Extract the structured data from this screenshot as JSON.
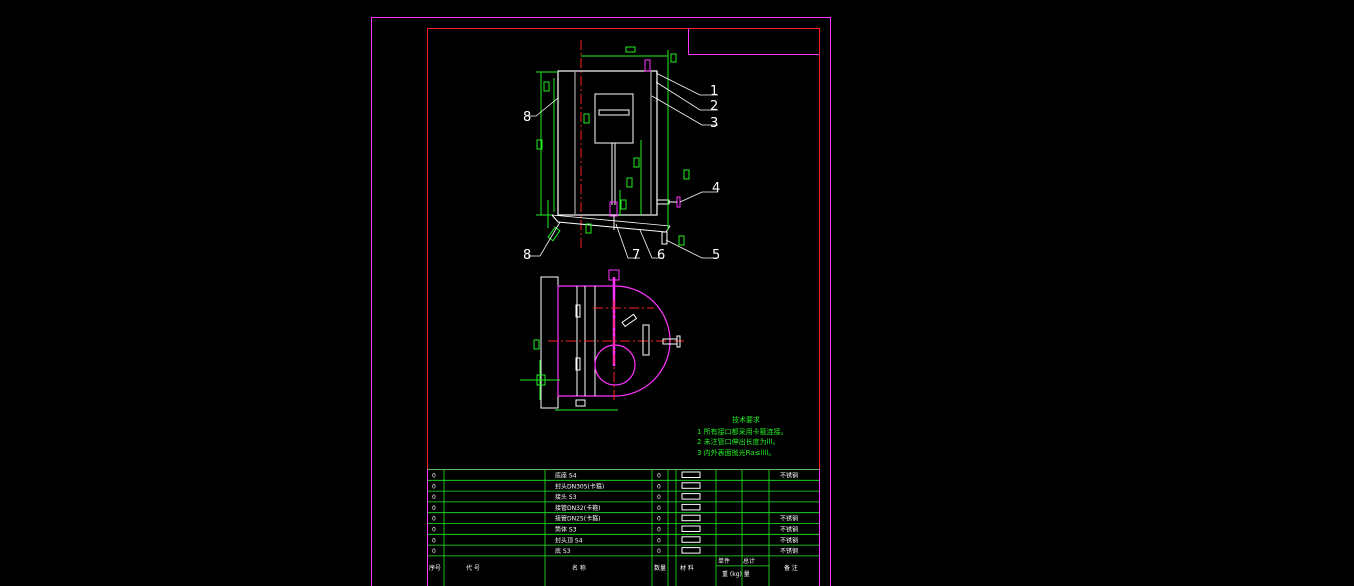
{
  "colors": {
    "background": "#000000",
    "sheet_border": "#ff33ff",
    "frame": "#ff2222",
    "geometry": "#ffffff",
    "dimension": "#22ee22",
    "center_line": "#ff2222",
    "highlight": "#ff33ff",
    "leader_text": "#ffffff"
  },
  "callouts": [
    "1",
    "2",
    "3",
    "4",
    "5",
    "6",
    "7",
    "8",
    "8"
  ],
  "notes": {
    "title": "技术要求",
    "items": [
      "1 所有接口都采用卡箍连接。",
      "2 未注管口伸出长度为lll。",
      "3 内外表面抛光Ra≤llll。"
    ]
  },
  "bom": {
    "rows": [
      {
        "idx": "0",
        "name": "底座 S4",
        "qty": "0",
        "material": "不锈钢",
        "note": ""
      },
      {
        "idx": "0",
        "name": "封头DN305(卡箍)",
        "qty": "0",
        "material": "",
        "note": ""
      },
      {
        "idx": "0",
        "name": "接头 S3",
        "qty": "0",
        "material": "",
        "note": ""
      },
      {
        "idx": "0",
        "name": "接管DN32(卡箍)",
        "qty": "0",
        "material": "",
        "note": ""
      },
      {
        "idx": "0",
        "name": "接管DN25(卡箍)",
        "qty": "0",
        "material": "不锈钢",
        "note": ""
      },
      {
        "idx": "0",
        "name": "筒体 S3",
        "qty": "0",
        "material": "不锈钢",
        "note": ""
      },
      {
        "idx": "0",
        "name": "封头顶 S4",
        "qty": "0",
        "material": "不锈钢",
        "note": ""
      },
      {
        "idx": "0",
        "name": "底 S3",
        "qty": "0",
        "material": "不锈钢",
        "note": ""
      }
    ],
    "header": {
      "no": "序号",
      "code": "代  号",
      "name": "名  称",
      "qty": "数量",
      "material": "材  料",
      "single": "单件",
      "total": "总计",
      "weight": "重 (kg) 量",
      "remark": "备  注"
    }
  }
}
